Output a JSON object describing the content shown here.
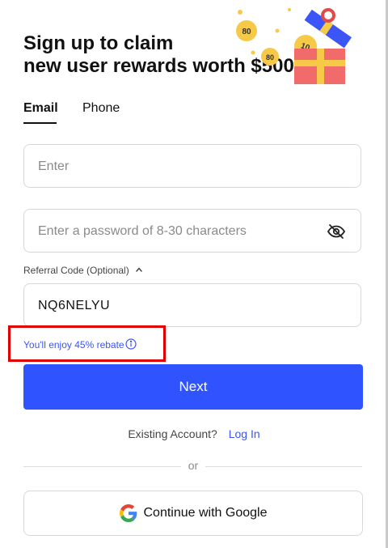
{
  "header": {
    "title_line1": "Sign up to claim",
    "title_line2": "new user rewards worth $5000+",
    "illustration": {
      "coin_labels": [
        "80",
        "10",
        "80"
      ],
      "gift_colors": {
        "box": "#f26b6b",
        "ribbon": "#f7c948",
        "lid": "#3b55f6",
        "bow": "#e04a4a"
      }
    }
  },
  "tabs": [
    {
      "label": "Email",
      "active": true
    },
    {
      "label": "Phone",
      "active": false
    }
  ],
  "form": {
    "email": {
      "placeholder": "Enter",
      "value": ""
    },
    "password": {
      "placeholder": "Enter a password of 8-30 characters",
      "value": "",
      "toggle_icon": "eye-slash-icon"
    },
    "referral": {
      "label": "Referral Code (Optional)",
      "toggle_icon": "chevron-up-icon",
      "value": "NQ6NELYU",
      "rebate_text": "You'll enjoy 45% rebate",
      "info_icon": "info-icon"
    }
  },
  "actions": {
    "next_label": "Next",
    "existing_text": "Existing Account?",
    "login_label": "Log In",
    "or_text": "or",
    "google_label": "Continue with Google"
  },
  "colors": {
    "accent": "#2f54ff",
    "link": "#3b55f6",
    "highlight_box": "#e00000"
  }
}
